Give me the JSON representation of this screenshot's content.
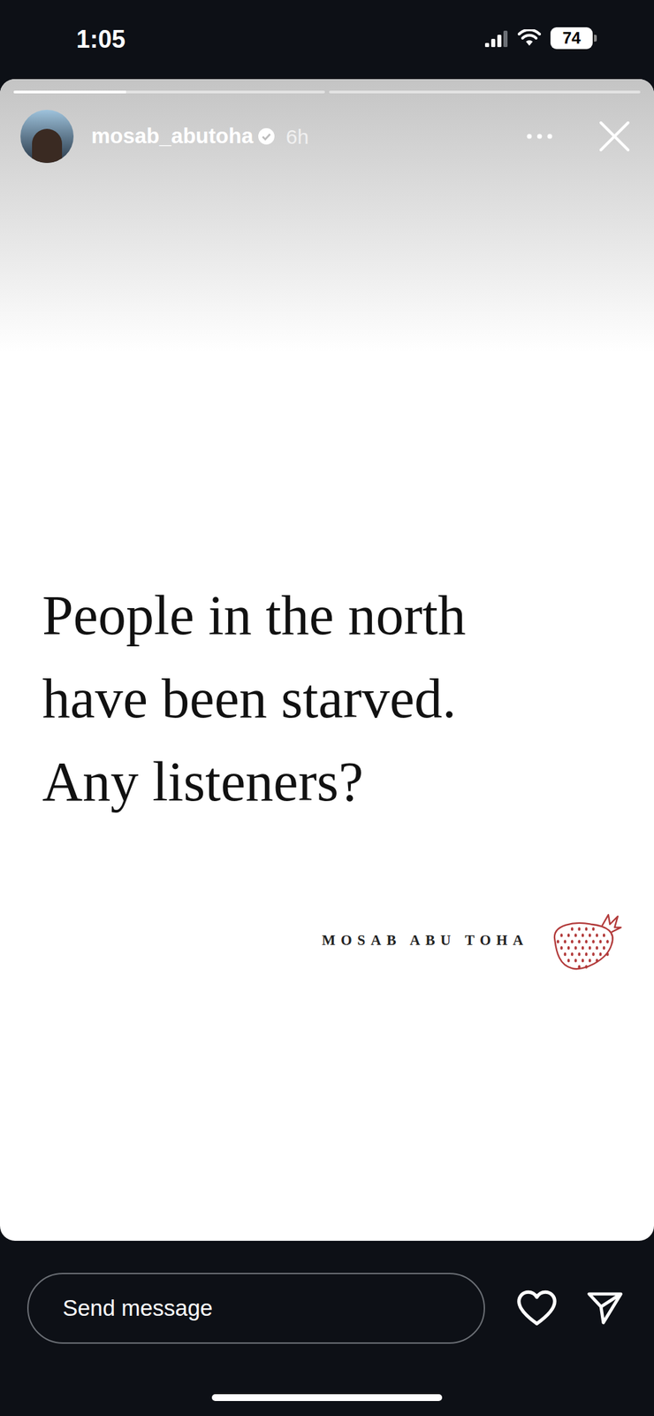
{
  "status_bar": {
    "time": "1:05",
    "battery": "74",
    "signal_bars": 3
  },
  "story": {
    "progress": [
      {
        "level": 0.36
      },
      {
        "level": 0
      }
    ],
    "author": {
      "username": "mosab_abutoha",
      "verified": true,
      "time": "6h"
    },
    "text_lines": [
      "People in the north",
      "have been starved.",
      "Any listeners?"
    ],
    "signature": "MOSAB ABU TOHA"
  },
  "reply_bar": {
    "placeholder": "Send message"
  }
}
